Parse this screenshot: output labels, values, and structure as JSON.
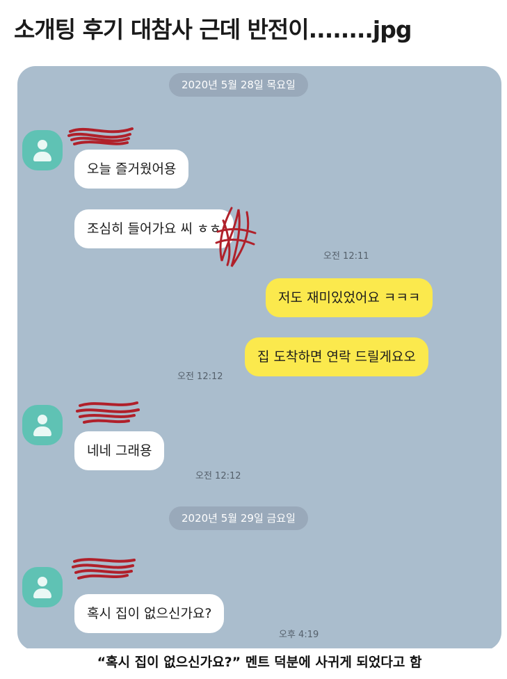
{
  "post": {
    "title": "소개팅 후기 대참사 근데 반전이........jpg",
    "caption": "“혹시 집이 없으신가요?” 멘트 덕분에 사귀게 되었다고 함"
  },
  "colors": {
    "chat_background": "#aabdcd",
    "incoming_bubble": "#ffffff",
    "outgoing_bubble": "#fbe94d",
    "avatar": "#5fc2b4",
    "redaction": "#b0202a"
  },
  "chat": {
    "date_1": "2020년 5월 28일 목요일",
    "date_2": "2020년 5월 29일 금요일",
    "messages": [
      {
        "sender": "them",
        "text": "오늘 즐거웠어용",
        "time": ""
      },
      {
        "sender": "them",
        "text": "조심히 들어가요 ",
        "suffix": "씨 ㅎㅎ",
        "time": "오전 12:11"
      },
      {
        "sender": "me",
        "text": "저도 재미있었어요 ㅋㅋㅋ",
        "time": ""
      },
      {
        "sender": "me",
        "text": "집 도착하면 연락 드릴게요오",
        "time": "오전 12:12"
      },
      {
        "sender": "them",
        "text": "네네 그래용",
        "time": "오전 12:12"
      },
      {
        "sender": "them",
        "text": "혹시 집이 없으신가요?",
        "time": "오후 4:19"
      }
    ]
  },
  "icons": {
    "avatar": "default-profile-icon",
    "redaction": "red-scribble-redaction"
  }
}
